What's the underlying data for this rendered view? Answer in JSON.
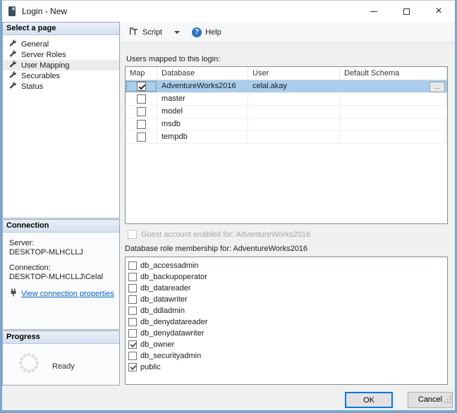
{
  "colors": {
    "selection_row": "#a9cdeb",
    "link": "#0563c1",
    "focus_button_border": "#0078d7",
    "window_border": "#7ba5c9",
    "help_icon": "#2b76c4"
  },
  "window": {
    "title": "Login - New"
  },
  "sidebar": {
    "select_page": {
      "header": "Select a page",
      "items": [
        {
          "label": "General",
          "selected": false
        },
        {
          "label": "Server Roles",
          "selected": false
        },
        {
          "label": "User Mapping",
          "selected": true
        },
        {
          "label": "Securables",
          "selected": false
        },
        {
          "label": "Status",
          "selected": false
        }
      ]
    },
    "connection": {
      "header": "Connection",
      "server_label": "Server:",
      "server_value": "DESKTOP-MLHCLLJ",
      "connection_label": "Connection:",
      "connection_value": "DESKTOP-MLHCLLJ\\Celal",
      "view_link": "View connection properties"
    },
    "progress": {
      "header": "Progress",
      "status": "Ready"
    }
  },
  "toolbar": {
    "script_label": "Script",
    "help_label": "Help"
  },
  "main": {
    "users_mapped_label": "Users mapped to this login:",
    "table": {
      "columns": [
        "Map",
        "Database",
        "User",
        "Default Schema"
      ],
      "rows": [
        {
          "map_checked": true,
          "database": "AdventureWorks2016",
          "user": "celal.akay",
          "default_schema": "",
          "selected": true,
          "browse_label": "..."
        },
        {
          "map_checked": false,
          "database": "master",
          "user": "",
          "default_schema": "",
          "selected": false
        },
        {
          "map_checked": false,
          "database": "model",
          "user": "",
          "default_schema": "",
          "selected": false
        },
        {
          "map_checked": false,
          "database": "msdb",
          "user": "",
          "default_schema": "",
          "selected": false
        },
        {
          "map_checked": false,
          "database": "tempdb",
          "user": "",
          "default_schema": "",
          "selected": false
        }
      ]
    },
    "guest_checkbox_label": "Guest account enabled for: AdventureWorks2016",
    "guest_checkbox_enabled": false,
    "role_membership_label": "Database role membership for: AdventureWorks2016",
    "roles": [
      {
        "name": "db_accessadmin",
        "checked": false
      },
      {
        "name": "db_backupoperator",
        "checked": false
      },
      {
        "name": "db_datareader",
        "checked": false
      },
      {
        "name": "db_datawriter",
        "checked": false
      },
      {
        "name": "db_ddladmin",
        "checked": false
      },
      {
        "name": "db_denydatareader",
        "checked": false
      },
      {
        "name": "db_denydatawriter",
        "checked": false
      },
      {
        "name": "db_owner",
        "checked": true
      },
      {
        "name": "db_securityadmin",
        "checked": false
      },
      {
        "name": "public",
        "checked": true
      }
    ]
  },
  "footer": {
    "ok_label": "OK",
    "cancel_label": "Cancel"
  }
}
